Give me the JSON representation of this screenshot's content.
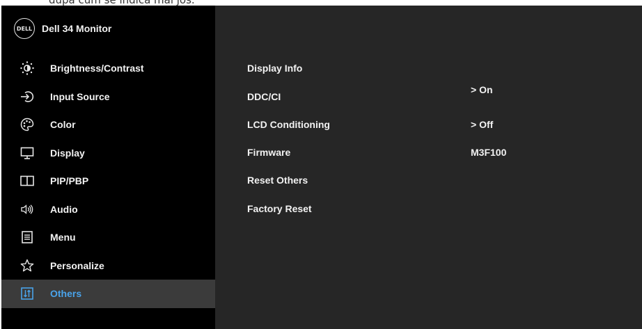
{
  "caption_text": "după cum se indică mai jos.",
  "header": {
    "logo_text": "DELL",
    "title": "Dell 34 Monitor"
  },
  "sidebar": {
    "items": [
      {
        "label": "Brightness/Contrast",
        "icon": "brightness-icon"
      },
      {
        "label": "Input Source",
        "icon": "input-source-icon"
      },
      {
        "label": "Color",
        "icon": "color-palette-icon"
      },
      {
        "label": "Display",
        "icon": "display-icon"
      },
      {
        "label": "PIP/PBP",
        "icon": "pip-pbp-icon"
      },
      {
        "label": "Audio",
        "icon": "audio-icon"
      },
      {
        "label": "Menu",
        "icon": "menu-icon"
      },
      {
        "label": "Personalize",
        "icon": "star-icon"
      },
      {
        "label": "Others",
        "icon": "others-icon",
        "active": true
      }
    ]
  },
  "others_panel": {
    "options": [
      {
        "label": "Display Info",
        "value": ""
      },
      {
        "label": "DDC/CI",
        "value": "> On"
      },
      {
        "label": "LCD Conditioning",
        "value": "> Off"
      },
      {
        "label": "Firmware",
        "value": "M3F100"
      },
      {
        "label": "Reset Others",
        "value": ""
      },
      {
        "label": "Factory Reset",
        "value": ""
      }
    ]
  },
  "colors": {
    "background": "#262626",
    "sidebar": "#000000",
    "active_item": "#3b3b3b",
    "accent": "#4aa3ea",
    "text": "#f2f2f2"
  }
}
